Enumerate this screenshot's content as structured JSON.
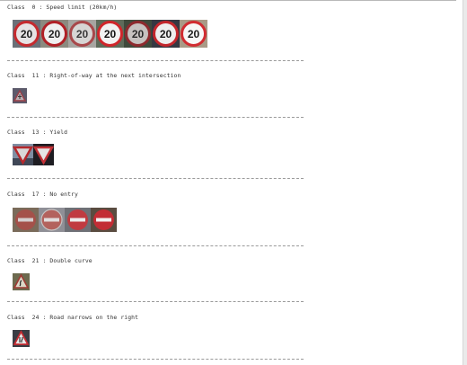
{
  "sections": [
    {
      "label": "Class  0 : Speed limit (20km/h)",
      "sign_text": "20"
    },
    {
      "label": "Class  11 : Right-of-way at the next intersection"
    },
    {
      "label": "Class  13 : Yield"
    },
    {
      "label": "Class  17 : No entry"
    },
    {
      "label": "Class  21 : Double curve"
    },
    {
      "label": "Class  24 : Road narrows on the right"
    }
  ]
}
